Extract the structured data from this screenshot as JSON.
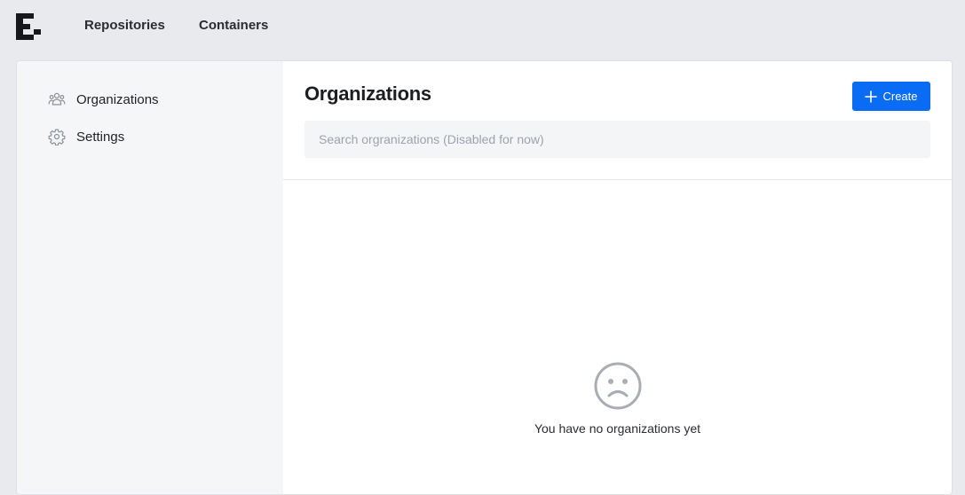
{
  "topnav": {
    "items": [
      {
        "label": "Repositories"
      },
      {
        "label": "Containers"
      }
    ]
  },
  "sidebar": {
    "items": [
      {
        "label": "Organizations",
        "icon": "users-icon"
      },
      {
        "label": "Settings",
        "icon": "gear-icon"
      }
    ]
  },
  "main": {
    "title": "Organizations",
    "create_label": "Create",
    "search_placeholder": "Search orgranizations (Disabled for now)",
    "empty_message": "You have no organizations yet"
  },
  "colors": {
    "accent": "#0a6cf5",
    "background": "#e9eaee",
    "sidebar": "#f5f6f8",
    "icon_gray": "#a9adb4"
  }
}
